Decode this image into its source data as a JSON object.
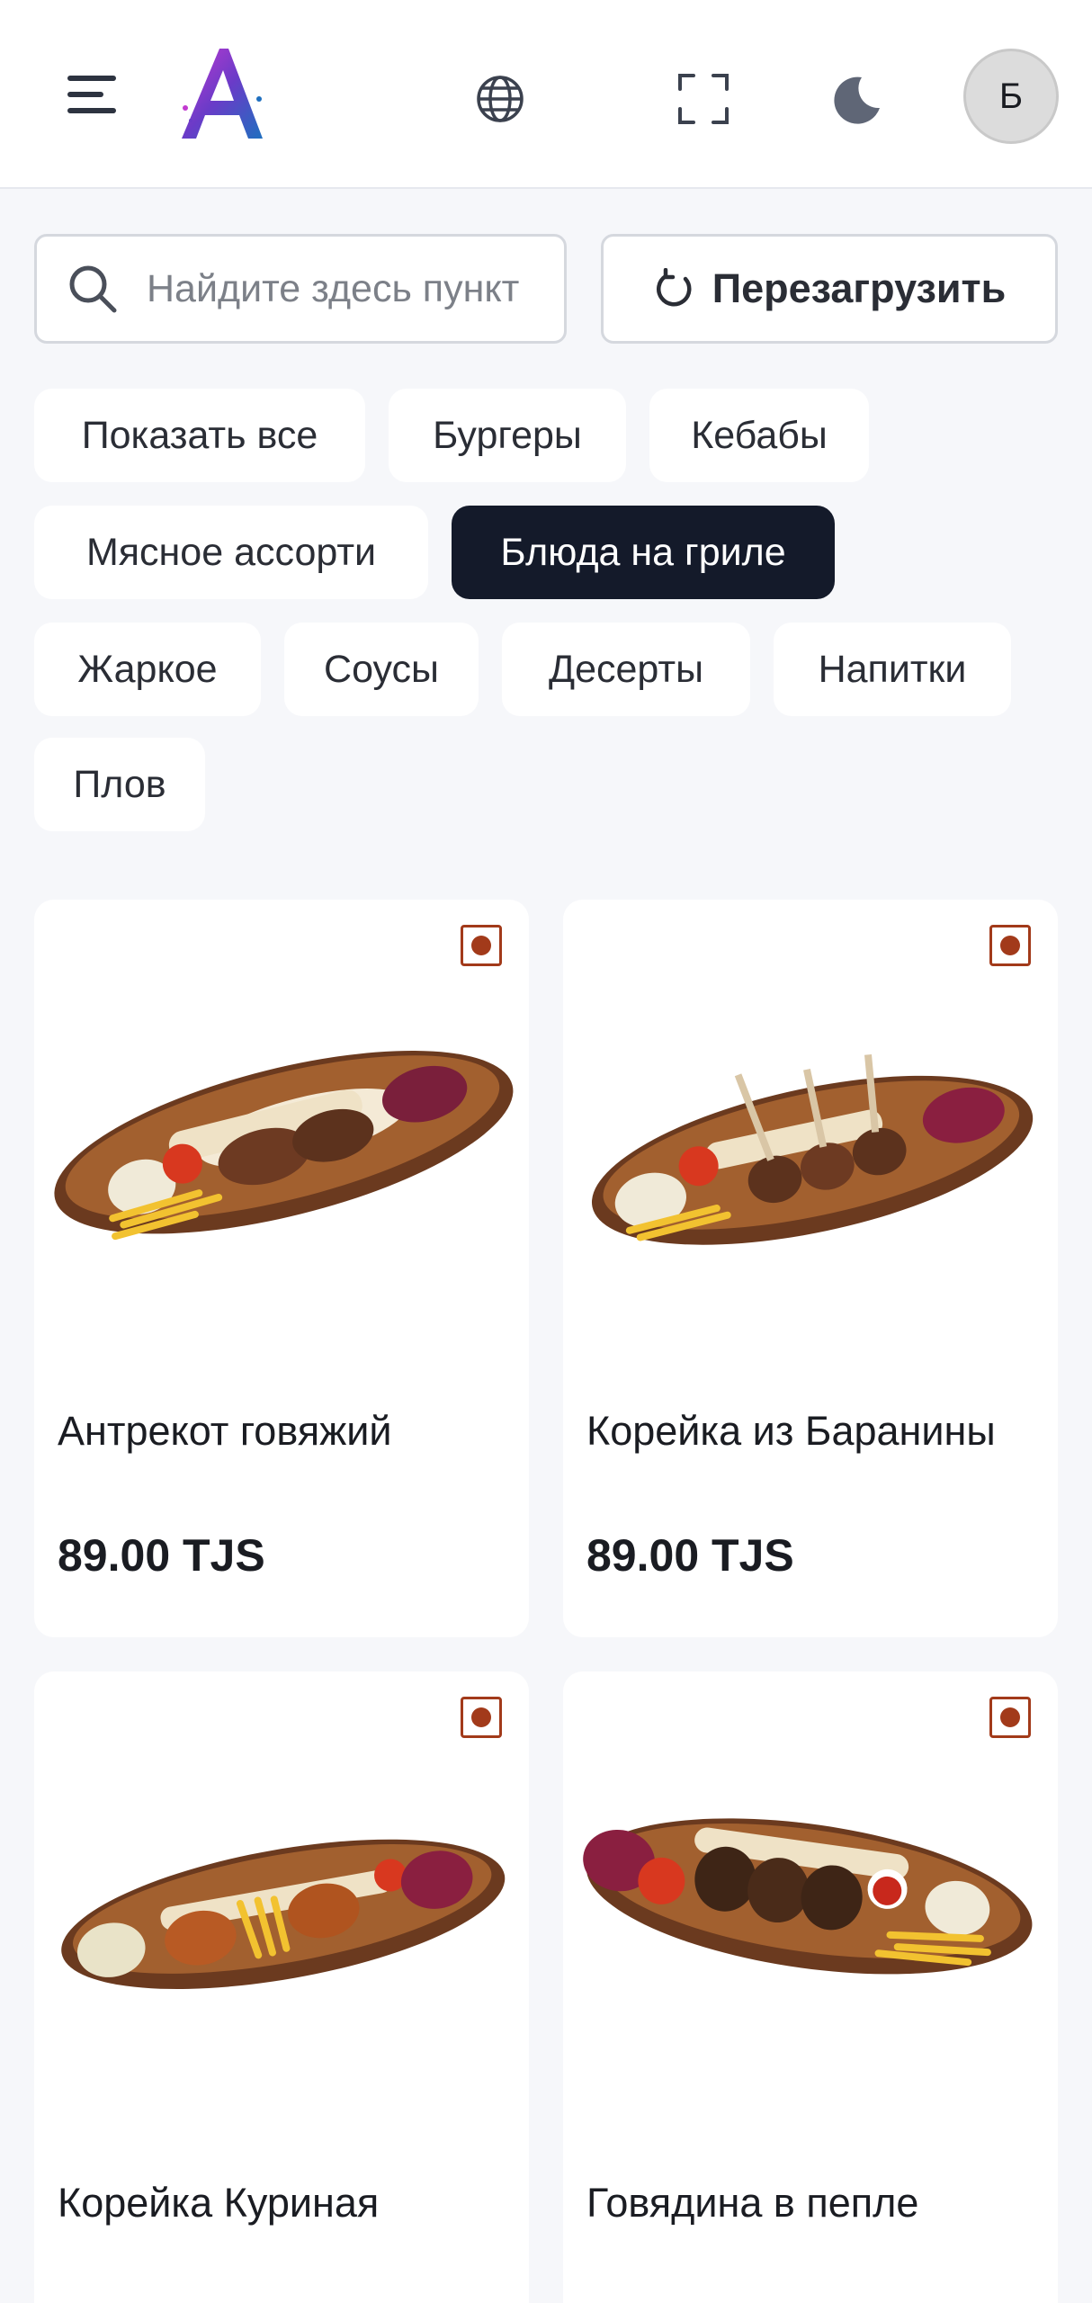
{
  "header": {
    "avatar_letter": "Б",
    "icons": [
      "menu-icon",
      "logo",
      "globe-icon",
      "fullscreen-icon",
      "moon-icon"
    ]
  },
  "search": {
    "placeholder": "Найдите здесь пункт",
    "value": ""
  },
  "reload": {
    "label": "Перезагрузить"
  },
  "categories": [
    {
      "label": "Показать все",
      "active": false
    },
    {
      "label": "Бургеры",
      "active": false
    },
    {
      "label": "Кебабы",
      "active": false
    },
    {
      "label": "Мясное ассорти",
      "active": false
    },
    {
      "label": "Блюда на гриле",
      "active": true
    },
    {
      "label": "Жаркое",
      "active": false
    },
    {
      "label": "Соусы",
      "active": false
    },
    {
      "label": "Десерты",
      "active": false
    },
    {
      "label": "Напитки",
      "active": false
    },
    {
      "label": "Плов",
      "active": false
    }
  ],
  "products": [
    {
      "name": "Антрекот говяжий",
      "price": "89.00 TJS"
    },
    {
      "name": "Корейка из Баранины",
      "price": "89.00 TJS"
    },
    {
      "name": "Корейка Куриная",
      "price": ""
    },
    {
      "name": "Говядина в пепле",
      "price": ""
    }
  ],
  "colors": {
    "accent": "#141a2a",
    "badge": "#a23a1a",
    "background": "#f6f7fa"
  }
}
